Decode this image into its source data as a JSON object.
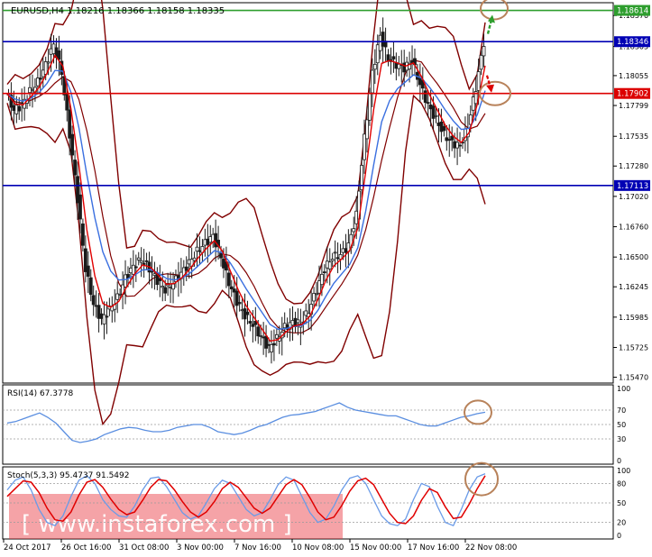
{
  "chart_data": {
    "type": "candlestick",
    "header": "EURUSD,H4  1.18216 1.18366 1.18158 1.18335",
    "symbol": "EURUSD",
    "timeframe": "H4",
    "ohlc_last": [
      1.18216,
      1.18366,
      1.18158,
      1.18335
    ],
    "price_axis": {
      "range": [
        1.1542,
        1.1868
      ],
      "ticks": [
        "1.18570",
        "1.18305",
        "1.18055",
        "1.17799",
        "1.17535",
        "1.17280",
        "1.17020",
        "1.16760",
        "1.16500",
        "1.16245",
        "1.15985",
        "1.15725",
        "1.15470"
      ]
    },
    "time_axis": {
      "labels": [
        "24 Oct 2017",
        "26 Oct 16:00",
        "31 Oct 08:00",
        "3 Nov 00:00",
        "7 Nov 16:00",
        "10 Nov 08:00",
        "15 Nov 00:00",
        "17 Nov 16:00",
        "22 Nov 08:00"
      ]
    },
    "levels": [
      {
        "label": "1.18614",
        "value": 1.18614,
        "color": "#2e9e2e"
      },
      {
        "label": "1.18346",
        "value": 1.18346,
        "color": "#0000b4"
      },
      {
        "label": "1.17902",
        "value": 1.17902,
        "color": "#dc0000"
      },
      {
        "label": "1.17113",
        "value": 1.17113,
        "color": "#0000b4"
      }
    ],
    "price_series": [
      1.179,
      1.1776,
      1.178,
      1.1792,
      1.18,
      1.1815,
      1.1832,
      1.1808,
      1.1755,
      1.17,
      1.164,
      1.161,
      1.1596,
      1.1605,
      1.1615,
      1.1632,
      1.1642,
      1.1648,
      1.164,
      1.163,
      1.1622,
      1.1628,
      1.1636,
      1.1645,
      1.1655,
      1.1662,
      1.1668,
      1.165,
      1.1628,
      1.1612,
      1.16,
      1.1592,
      1.1582,
      1.1572,
      1.158,
      1.159,
      1.1594,
      1.1593,
      1.1604,
      1.1622,
      1.164,
      1.165,
      1.1652,
      1.166,
      1.1686,
      1.1752,
      1.1808,
      1.184,
      1.182,
      1.1815,
      1.1812,
      1.1818,
      1.1798,
      1.178,
      1.1768,
      1.1755,
      1.1748,
      1.1745,
      1.1762,
      1.1795,
      1.1834
    ],
    "colors": {
      "candle": "#1a1a1a",
      "ma_fast": "#e00000",
      "ma_slow": "#3a6fe0",
      "bollinger": "#800000",
      "rsi": "#5a8ee0",
      "stoch_main": "#6a9be8",
      "stoch_signal": "#e00000",
      "annotation": "#b8825a",
      "arrow_up": "#2e9e2e",
      "arrow_down": "#dc0000",
      "watermark": "#e8323c"
    },
    "rsi": {
      "label": "RSI(14) 67.3778",
      "period": 14,
      "last": 67.3778,
      "axis_labels": [
        "100",
        "70",
        "50",
        "30",
        "0"
      ],
      "levels": [
        70,
        50,
        30
      ],
      "values": [
        52,
        54,
        58,
        62,
        66,
        60,
        52,
        40,
        28,
        25,
        27,
        30,
        36,
        40,
        44,
        46,
        45,
        42,
        40,
        40,
        42,
        46,
        48,
        50,
        50,
        46,
        40,
        38,
        36,
        38,
        42,
        47,
        50,
        55,
        60,
        63,
        64,
        66,
        68,
        72,
        76,
        80,
        74,
        70,
        68,
        66,
        64,
        62,
        62,
        58,
        54,
        50,
        48,
        48,
        52,
        56,
        60,
        62,
        65,
        67
      ]
    },
    "stoch": {
      "label": "Stoch(5,3,3) 95.4737 91.5492",
      "params": [
        5,
        3,
        3
      ],
      "main": 95.4737,
      "signal": 91.5492,
      "axis_labels": [
        "100",
        "80",
        "50",
        "20",
        "0"
      ],
      "levels": [
        80,
        50,
        20
      ],
      "main_values": [
        70,
        85,
        90,
        70,
        40,
        20,
        15,
        30,
        60,
        85,
        92,
        80,
        55,
        40,
        30,
        28,
        45,
        70,
        88,
        90,
        75,
        55,
        35,
        25,
        30,
        50,
        72,
        85,
        80,
        60,
        40,
        30,
        35,
        55,
        78,
        90,
        85,
        60,
        35,
        20,
        25,
        45,
        70,
        88,
        92,
        80,
        55,
        30,
        18,
        15,
        25,
        55,
        80,
        75,
        45,
        20,
        15,
        40,
        70,
        90,
        95
      ],
      "signal_values": [
        60,
        72,
        84,
        82,
        66,
        42,
        24,
        22,
        36,
        62,
        82,
        86,
        74,
        56,
        40,
        32,
        36,
        54,
        74,
        86,
        84,
        70,
        52,
        36,
        28,
        36,
        52,
        72,
        82,
        74,
        58,
        42,
        34,
        42,
        60,
        78,
        86,
        78,
        58,
        36,
        24,
        28,
        46,
        68,
        84,
        88,
        78,
        56,
        34,
        20,
        18,
        30,
        54,
        72,
        66,
        44,
        26,
        28,
        48,
        72,
        92
      ]
    },
    "watermark": "[  www.instaforex.com  ]"
  }
}
